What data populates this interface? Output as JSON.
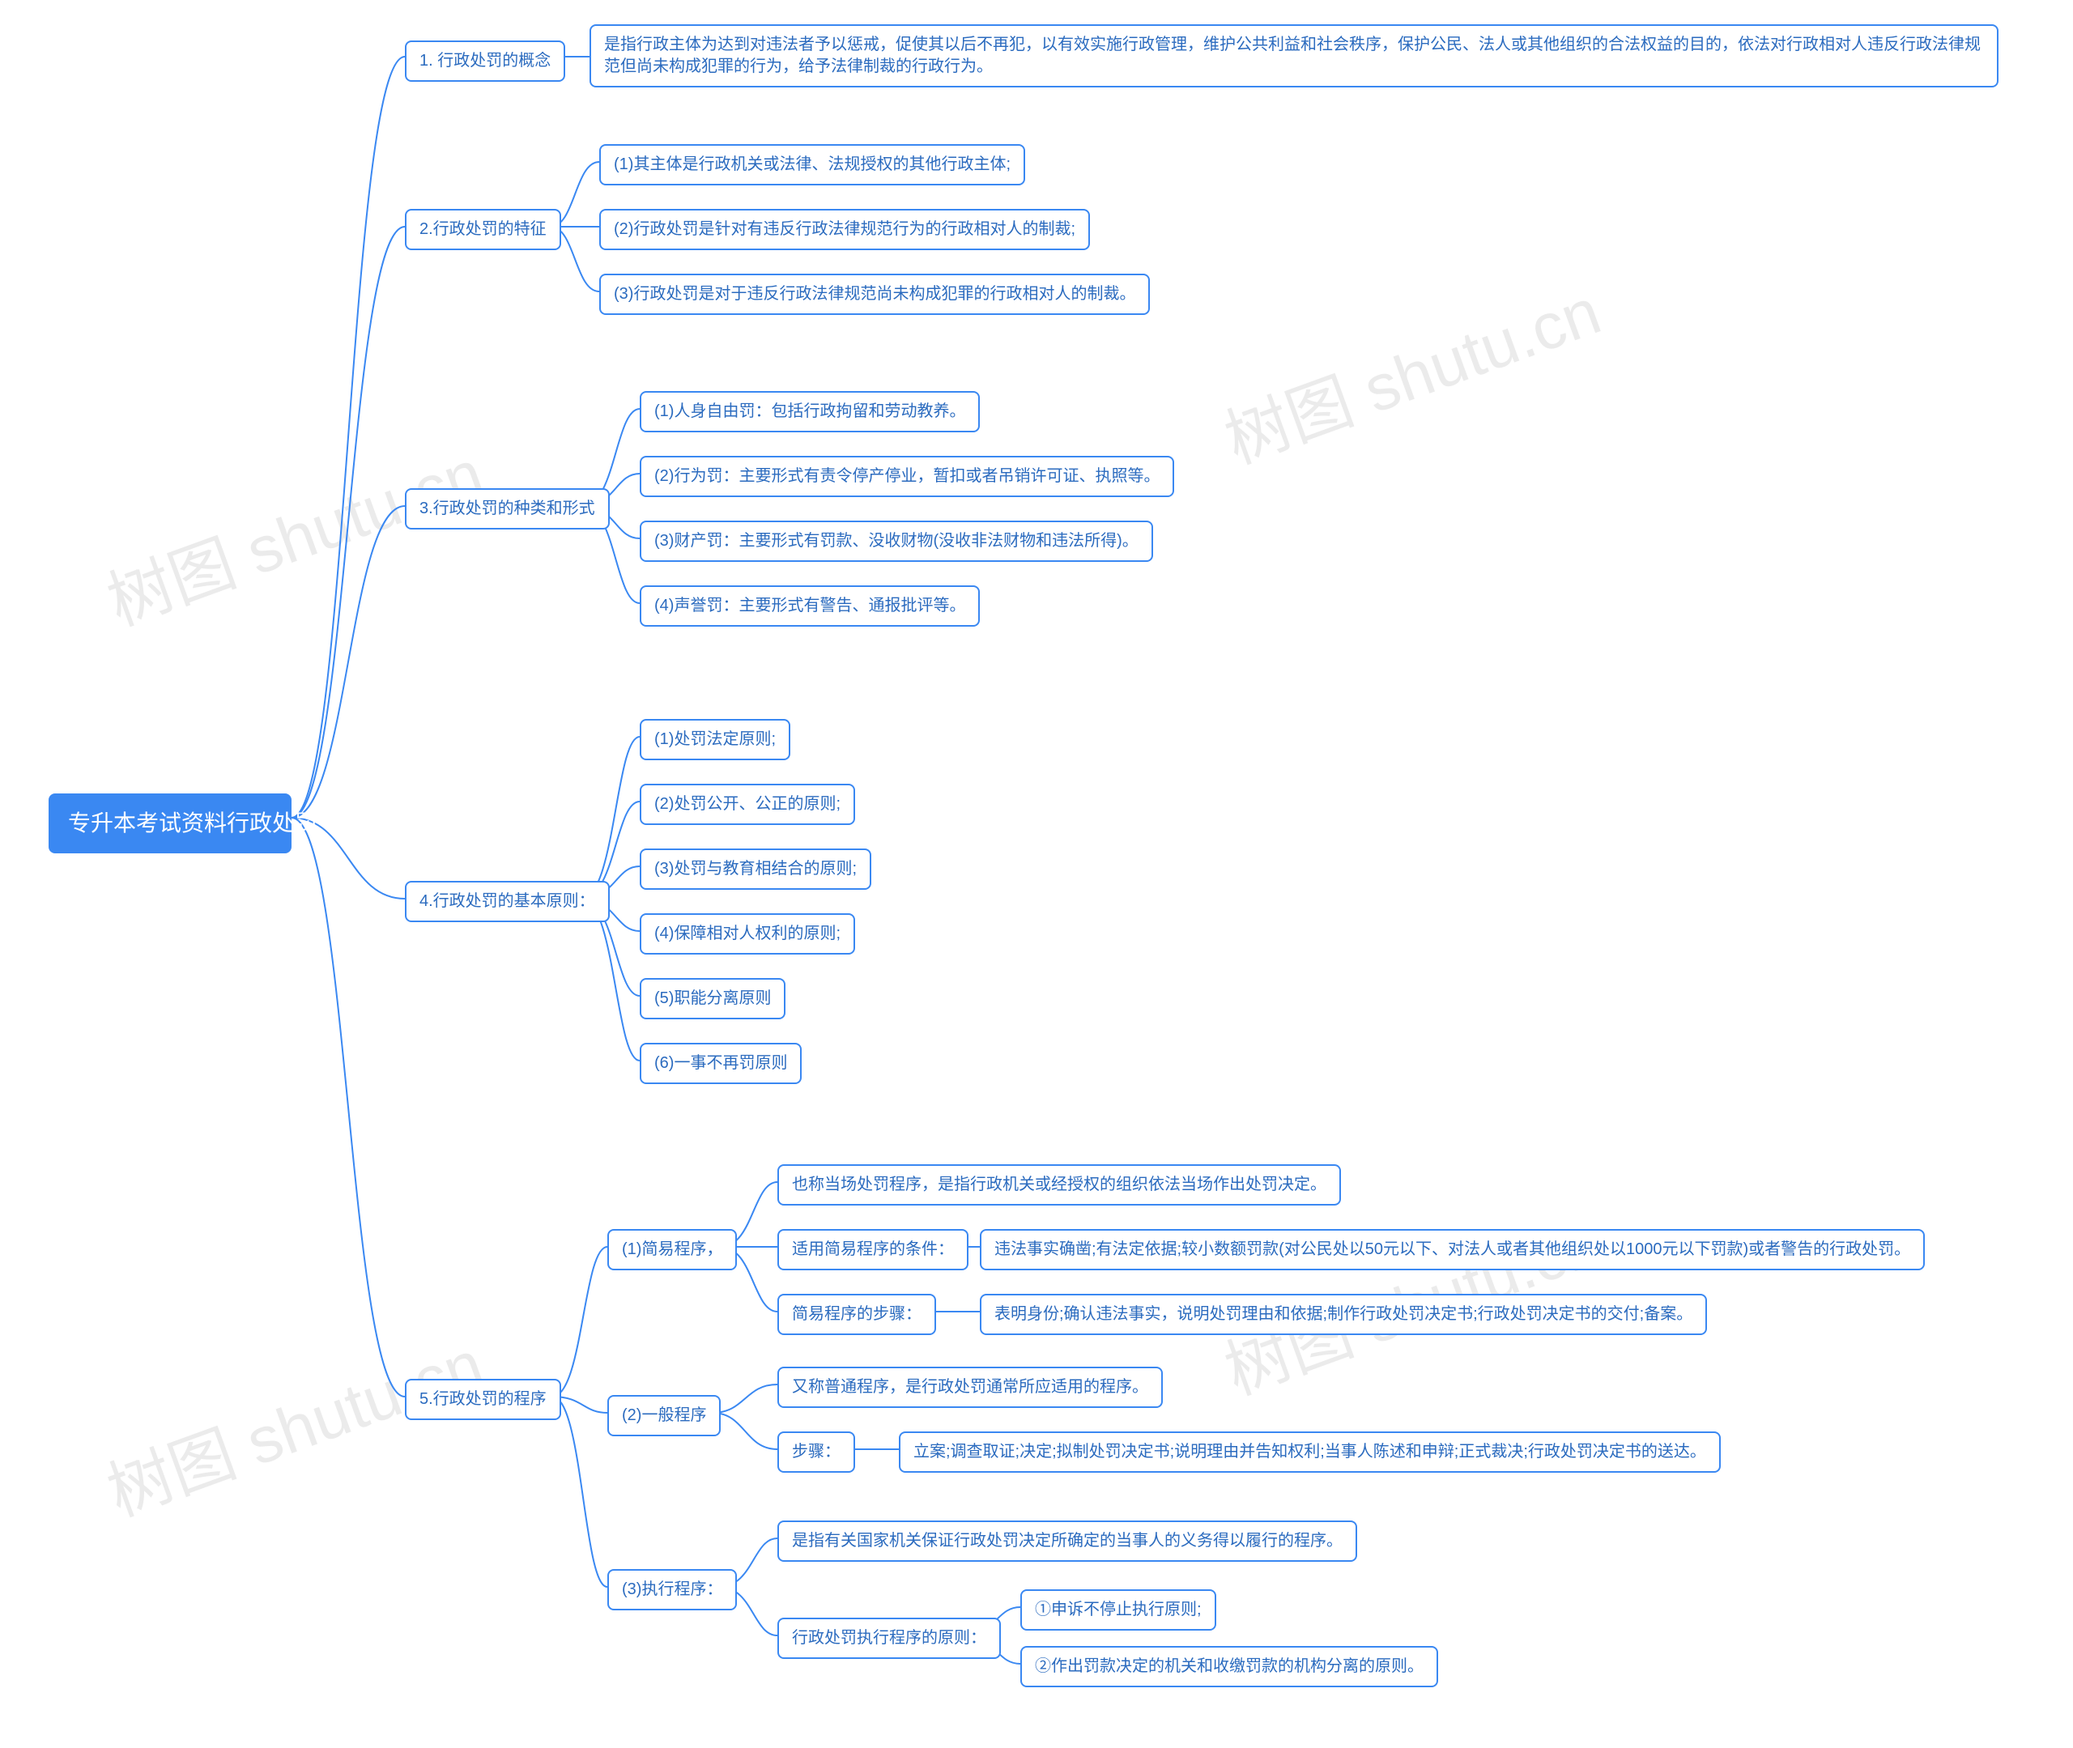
{
  "root": "专升本考试资料行政处罚",
  "b1": "1. 行政处罚的概念",
  "b1_1": "是指行政主体为达到对违法者予以惩戒，促使其以后不再犯，以有效实施行政管理，维护公共利益和社会秩序，保护公民、法人或其他组织的合法权益的目的，依法对行政相对人违反行政法律规范但尚未构成犯罪的行为，给予法律制裁的行政行为。",
  "b2": "2.行政处罚的特征",
  "b2_1": "(1)其主体是行政机关或法律、法规授权的其他行政主体;",
  "b2_2": "(2)行政处罚是针对有违反行政法律规范行为的行政相对人的制裁;",
  "b2_3": "(3)行政处罚是对于违反行政法律规范尚未构成犯罪的行政相对人的制裁。",
  "b3": "3.行政处罚的种类和形式",
  "b3_1": "(1)人身自由罚：包括行政拘留和劳动教养。",
  "b3_2": "(2)行为罚：主要形式有责令停产停业，暂扣或者吊销许可证、执照等。",
  "b3_3": "(3)财产罚：主要形式有罚款、没收财物(没收非法财物和违法所得)。",
  "b3_4": "(4)声誉罚：主要形式有警告、通报批评等。",
  "b4": "4.行政处罚的基本原则：",
  "b4_1": "(1)处罚法定原则;",
  "b4_2": "(2)处罚公开、公正的原则;",
  "b4_3": "(3)处罚与教育相结合的原则;",
  "b4_4": "(4)保障相对人权利的原则;",
  "b4_5": "(5)职能分离原则",
  "b4_6": "(6)一事不再罚原则",
  "b5": "5.行政处罚的程序",
  "b5_1": "(1)简易程序，",
  "b5_1_a": "也称当场处罚程序，是指行政机关或经授权的组织依法当场作出处罚决定。",
  "b5_1_b": "适用简易程序的条件：",
  "b5_1_b1": "违法事实确凿;有法定依据;较小数额罚款(对公民处以50元以下、对法人或者其他组织处以1000元以下罚款)或者警告的行政处罚。",
  "b5_1_c": "简易程序的步骤：",
  "b5_1_c1": "表明身份;确认违法事实，说明处罚理由和依据;制作行政处罚决定书;行政处罚决定书的交付;备案。",
  "b5_2": "(2)一般程序",
  "b5_2_a": "又称普通程序，是行政处罚通常所应适用的程序。",
  "b5_2_b": "步骤：",
  "b5_2_b1": "立案;调查取证;决定;拟制处罚决定书;说明理由并告知权利;当事人陈述和申辩;正式裁决;行政处罚决定书的送达。",
  "b5_3": "(3)执行程序：",
  "b5_3_a": "是指有关国家机关保证行政处罚决定所确定的当事人的义务得以履行的程序。",
  "b5_3_b": "行政处罚执行程序的原则：",
  "b5_3_b1": "①申诉不停止执行原则;",
  "b5_3_b2": "②作出罚款决定的机关和收缴罚款的机构分离的原则。",
  "watermark": "树图 shutu.cn"
}
